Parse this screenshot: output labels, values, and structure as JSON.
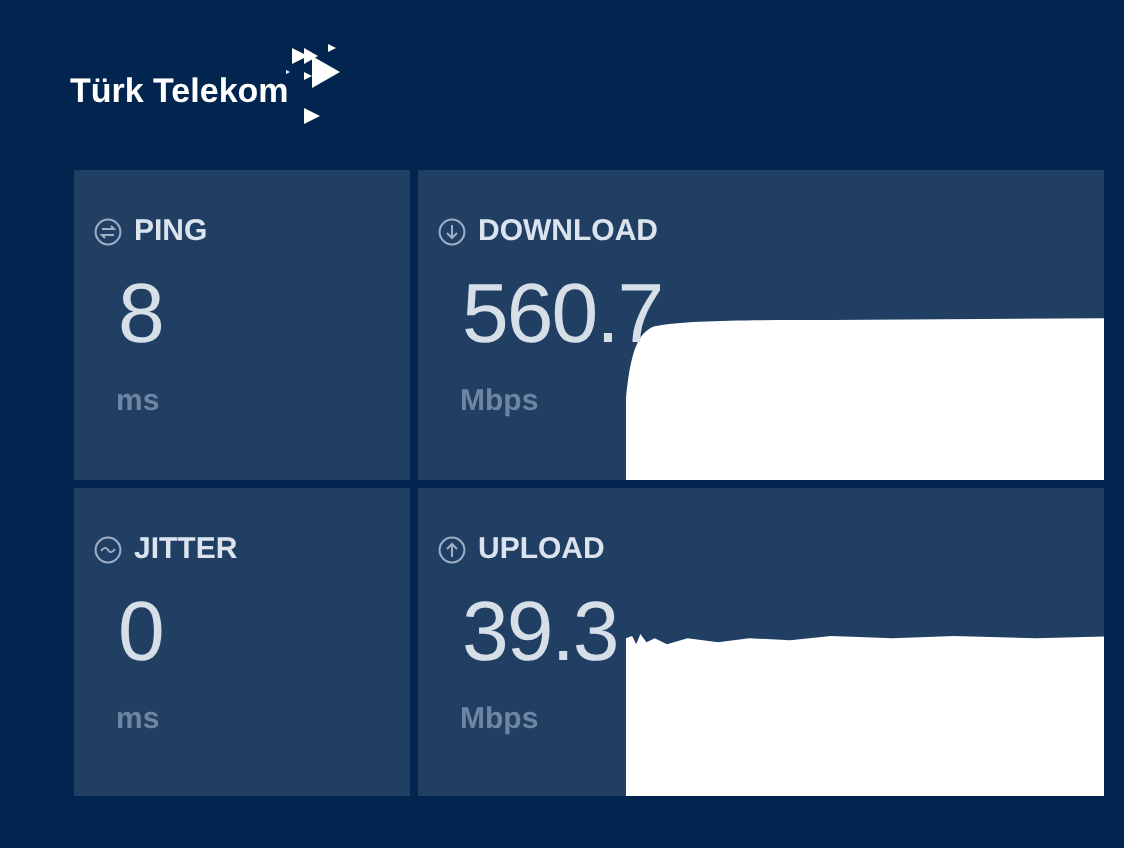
{
  "brand": {
    "name": "Türk Telekom"
  },
  "metrics": [
    {
      "kind": "ping",
      "label": "PING",
      "value": "8",
      "unit": "ms"
    },
    {
      "kind": "download",
      "label": "DOWNLOAD",
      "value": "560.7",
      "unit": "Mbps"
    },
    {
      "kind": "jitter",
      "label": "JITTER",
      "value": "0",
      "unit": "ms"
    },
    {
      "kind": "upload",
      "label": "UPLOAD",
      "value": "39.3",
      "unit": "Mbps"
    }
  ]
}
